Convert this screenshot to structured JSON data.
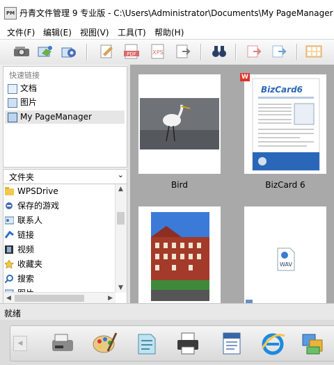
{
  "window": {
    "app_icon_text": "PM",
    "title": "丹青文件管理 9 专业版 - C:\\Users\\Administrator\\Documents\\My PageManager"
  },
  "menu": [
    "文件(F)",
    "编辑(E)",
    "视图(V)",
    "工具(T)",
    "帮助(H)"
  ],
  "toolbar": {
    "buttons": [
      "scanner-icon",
      "acquire-image-icon",
      "settings-gear-icon",
      "edit-document-icon",
      "pdf-icon",
      "xps-icon",
      "export-icon",
      "binoculars-find-icon",
      "send-icon",
      "transfer-icon",
      "thumbnail-view-icon"
    ],
    "pdf_text": "PDF",
    "xps_text": "XPS"
  },
  "quick_links": {
    "header": "快速链接",
    "items": [
      {
        "label": "文档",
        "icon": "document-icon"
      },
      {
        "label": "图片",
        "icon": "picture-icon"
      },
      {
        "label": "My PageManager",
        "icon": "folder-window-icon",
        "selected": true
      }
    ]
  },
  "folders": {
    "header": "文件夹",
    "items": [
      {
        "label": "WPSDrive",
        "icon": "folder-icon"
      },
      {
        "label": "保存的游戏",
        "icon": "saved-games-icon"
      },
      {
        "label": "联系人",
        "icon": "contacts-icon"
      },
      {
        "label": "链接",
        "icon": "link-icon"
      },
      {
        "label": "视频",
        "icon": "video-icon"
      },
      {
        "label": "收藏夹",
        "icon": "favorites-star-icon"
      },
      {
        "label": "搜索",
        "icon": "search-icon"
      },
      {
        "label": "图片",
        "icon": "picture-icon"
      }
    ]
  },
  "thumbnails": [
    {
      "label": "Bird",
      "kind": "photo"
    },
    {
      "label": "BizCard 6",
      "kind": "document"
    },
    {
      "label": "",
      "kind": "photo-building"
    },
    {
      "label": "",
      "kind": "wav"
    }
  ],
  "bizcard": {
    "brand": "BizCard6",
    "badge": "W"
  },
  "wav_label": "WAV",
  "status": {
    "text": "就绪"
  },
  "dock": {
    "buttons": [
      "fax-icon",
      "paint-palette-icon",
      "notepad-icon",
      "printer-icon",
      "word-document-icon",
      "internet-explorer-icon",
      "window-tiles-icon"
    ]
  }
}
